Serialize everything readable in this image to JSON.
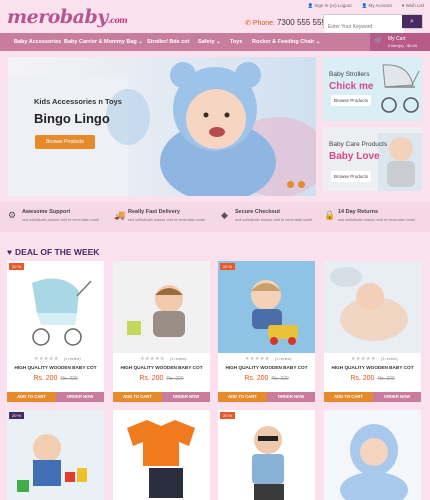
{
  "logo": {
    "text": "merobaby",
    "suffix": ".com"
  },
  "top_links": [
    "Sign In (or) Logout",
    "My Account",
    "Wish List"
  ],
  "phone": {
    "label": "Phone:",
    "number": "7300 555 555"
  },
  "search": {
    "placeholder": "Enter Your Keyword"
  },
  "nav": [
    {
      "label": "Baby Accessories"
    },
    {
      "label": "Baby Carrier & Mommy Bag ⌄"
    },
    {
      "label": "Stroller/ Bde cot"
    },
    {
      "label": "Safety ⌄"
    },
    {
      "label": "Toys"
    },
    {
      "label": "Rocker & Feeding Chair ⌄"
    }
  ],
  "cart": {
    "label": "My Cart",
    "summary": "0 item(s) - $0.00"
  },
  "hero": {
    "line1": "Kids Accessories n Toys",
    "line2": "Bingo Lingo",
    "button": "Browse Products"
  },
  "promos": [
    {
      "line1": "Baby Strollers",
      "line2": "Chick me",
      "button": "Browse Products"
    },
    {
      "line1": "Baby Care Products",
      "line2": "Baby Love",
      "button": "Browse Products"
    }
  ],
  "features": [
    {
      "title": "Awesome Support",
      "desc": "sed sollicitudin mauris velit et venenatis morbi"
    },
    {
      "title": "Really Fast Delivery",
      "desc": "sed sollicitudin mauris velit et venenatis morbi"
    },
    {
      "title": "Secure Checkout",
      "desc": "sed sollicitudin mauris velit et venenatis morbi"
    },
    {
      "title": "14 Day Returns",
      "desc": "sed sollicitudin mauris velit et venenatis morbi"
    }
  ],
  "deal_title": "DEAL OF THE WEEK",
  "products": [
    {
      "badge": "20 %",
      "name": "HIGH QUALITY WOODEN BABY COT",
      "price": "Rs. 200",
      "old": "Rs. 220",
      "reviews": "(1 review)",
      "add": "ADD TO CART",
      "order": "ORDER NOW"
    },
    {
      "badge": "",
      "name": "HIGH QUALITY WOODEN BABY COT",
      "price": "Rs. 200",
      "old": "Rs. 220",
      "reviews": "(1 review)",
      "add": "ADD TO CART",
      "order": "ORDER NOW"
    },
    {
      "badge": "20 %",
      "name": "HIGH QUALITY WOODEN BABY COT",
      "price": "Rs. 200",
      "old": "Rs. 220",
      "reviews": "(1 review)",
      "add": "ADD TO CART",
      "order": "ORDER NOW"
    },
    {
      "badge": "",
      "name": "HIGH QUALITY WOODEN BABY COT",
      "price": "Rs. 200",
      "old": "Rs. 220",
      "reviews": "(1 review)",
      "add": "ADD TO CART",
      "order": "ORDER NOW"
    }
  ],
  "second_row_badges": [
    "20 %",
    "",
    "20 %",
    ""
  ],
  "icons": {
    "support": "headset-icon",
    "delivery": "truck-icon",
    "checkout": "shield-icon",
    "returns": "lock-icon",
    "deal": "heart-icon",
    "cart": "cart-icon",
    "search": "search-icon"
  },
  "colors": {
    "accent_pink": "#c87d9f",
    "accent_orange": "#e68b2c",
    "deep_purple": "#4a2a63",
    "price": "#e0531c"
  }
}
